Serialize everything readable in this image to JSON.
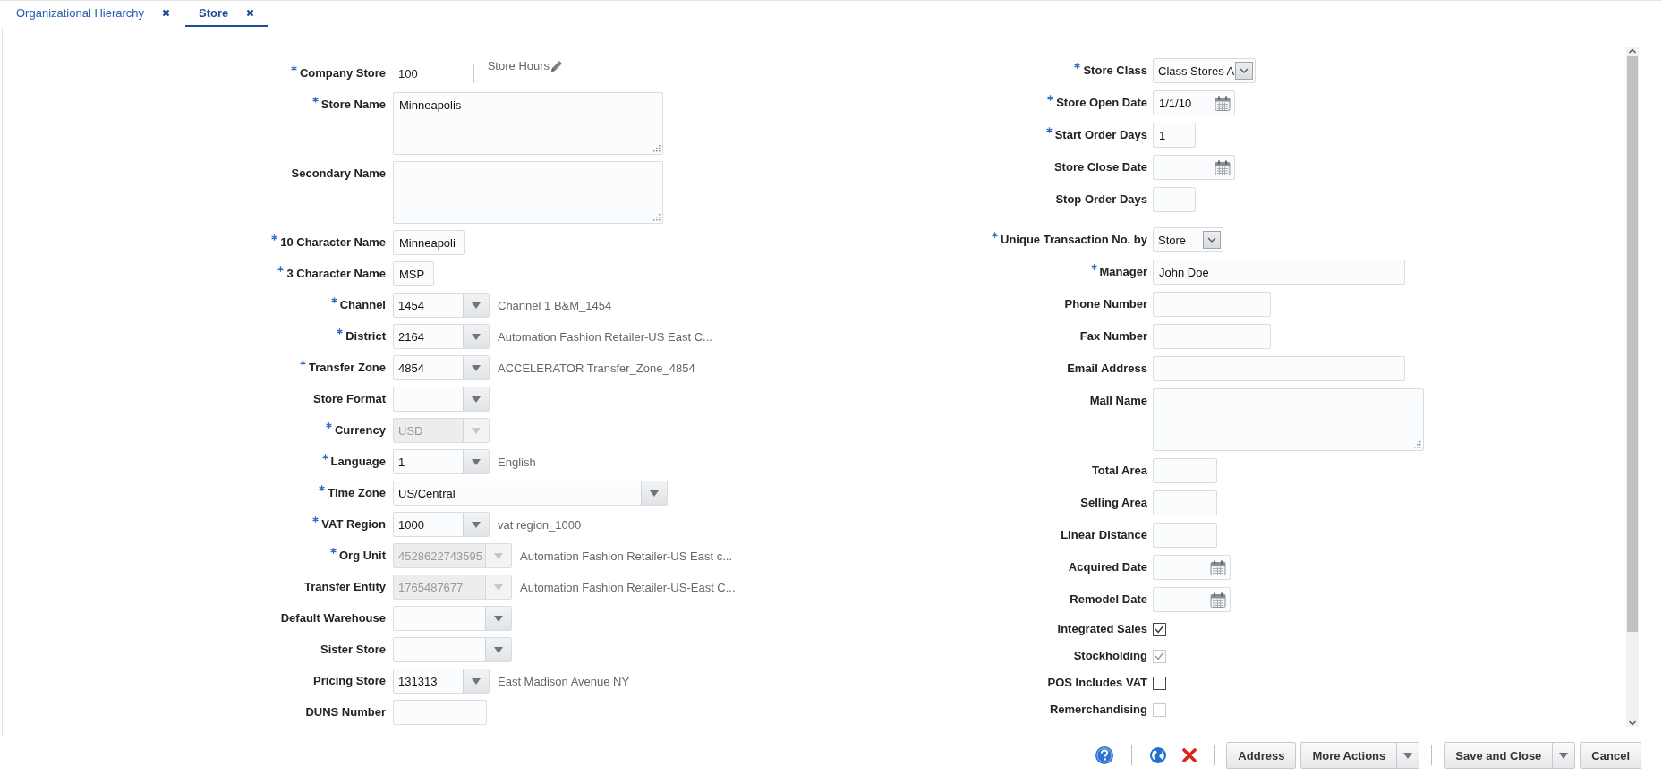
{
  "tabs": [
    {
      "label": "Organizational Hierarchy",
      "selected": false
    },
    {
      "label": "Store",
      "selected": true
    }
  ],
  "left_fields": [
    {
      "kind": "display",
      "label": "Company Store",
      "required": true,
      "disabled": false,
      "value": "100",
      "link": "Store Hours"
    },
    {
      "kind": "textarea",
      "label": "Store Name",
      "required": true,
      "disabled": false,
      "value": "Minneapolis"
    },
    {
      "kind": "textarea",
      "label": "Secondary Name",
      "required": false,
      "disabled": false
    },
    {
      "kind": "text",
      "label": "10 Character Name",
      "required": true,
      "disabled": false,
      "value": "Minneapoli"
    },
    {
      "kind": "text",
      "label": "3 Character Name",
      "required": true,
      "disabled": false,
      "value": "MSP"
    },
    {
      "kind": "select",
      "label": "Channel",
      "required": true,
      "disabled": false,
      "value": "1454",
      "description": "Channel 1 B&M_1454"
    },
    {
      "kind": "select",
      "label": "District",
      "required": true,
      "disabled": false,
      "value": "2164",
      "description": "Automation Fashion Retailer-US East C..."
    },
    {
      "kind": "select",
      "label": "Transfer Zone",
      "required": true,
      "disabled": false,
      "value": "4854",
      "description": "ACCELERATOR Transfer_Zone_4854"
    },
    {
      "kind": "select",
      "label": "Store Format",
      "required": false,
      "disabled": false
    },
    {
      "kind": "select",
      "label": "Currency",
      "required": true,
      "disabled": true,
      "value": "USD"
    },
    {
      "kind": "select",
      "label": "Language",
      "required": true,
      "disabled": false,
      "value": "1",
      "description": "English"
    },
    {
      "kind": "select",
      "label": "Time Zone",
      "required": true,
      "disabled": false,
      "value": "US/Central"
    },
    {
      "kind": "select",
      "label": "VAT Region",
      "required": true,
      "disabled": false,
      "value": "1000",
      "description": "vat region_1000"
    },
    {
      "kind": "select",
      "label": "Org Unit",
      "required": true,
      "disabled": true,
      "value": "4528622743595",
      "description": "Automation Fashion Retailer-US East c..."
    },
    {
      "kind": "select",
      "label": "Transfer Entity",
      "required": false,
      "disabled": true,
      "value": "1765487677",
      "description": "Automation Fashion Retailer-US-East C..."
    },
    {
      "kind": "select",
      "label": "Default Warehouse",
      "required": false,
      "disabled": false
    },
    {
      "kind": "select",
      "label": "Sister Store",
      "required": false,
      "disabled": false
    },
    {
      "kind": "select",
      "label": "Pricing Store",
      "required": false,
      "disabled": false,
      "value": "131313",
      "description": "East Madison Avenue NY"
    },
    {
      "kind": "text",
      "label": "DUNS Number",
      "required": false,
      "disabled": false
    }
  ],
  "right_fields": [
    {
      "kind": "choice",
      "label": "Store Class",
      "required": true,
      "disabled": false,
      "value": "Class Stores A"
    },
    {
      "kind": "date",
      "label": "Store Open Date",
      "required": true,
      "disabled": false,
      "value": "1/1/10"
    },
    {
      "kind": "text",
      "label": "Start Order Days",
      "required": true,
      "disabled": false,
      "value": "1"
    },
    {
      "kind": "date",
      "label": "Store Close Date",
      "required": false,
      "disabled": false
    },
    {
      "kind": "text",
      "label": "Stop Order Days",
      "required": false,
      "disabled": false
    },
    {
      "kind": "choice",
      "label": "Unique Transaction No. by",
      "required": true,
      "disabled": false,
      "value": "Store"
    },
    {
      "kind": "text",
      "label": "Manager",
      "required": true,
      "disabled": false,
      "value": "John Doe"
    },
    {
      "kind": "text",
      "label": "Phone Number",
      "required": false,
      "disabled": false
    },
    {
      "kind": "text",
      "label": "Fax Number",
      "required": false,
      "disabled": false
    },
    {
      "kind": "text",
      "label": "Email Address",
      "required": false,
      "disabled": false
    },
    {
      "kind": "textarea",
      "label": "Mall Name",
      "required": false,
      "disabled": false
    },
    {
      "kind": "text",
      "label": "Total Area",
      "required": false,
      "disabled": false
    },
    {
      "kind": "text",
      "label": "Selling Area",
      "required": false,
      "disabled": false
    },
    {
      "kind": "text",
      "label": "Linear Distance",
      "required": false,
      "disabled": false
    },
    {
      "kind": "date",
      "label": "Acquired Date",
      "required": false,
      "disabled": false
    },
    {
      "kind": "date",
      "label": "Remodel Date",
      "required": false,
      "disabled": false
    },
    {
      "kind": "checkbox",
      "label": "Integrated Sales",
      "required": false,
      "disabled": false,
      "checked": true
    },
    {
      "kind": "checkbox",
      "label": "Stockholding",
      "required": false,
      "disabled": true,
      "checked": true
    },
    {
      "kind": "checkbox",
      "label": "POS Includes VAT",
      "required": false,
      "disabled": false,
      "checked": false
    },
    {
      "kind": "checkbox",
      "label": "Remerchandising",
      "required": false,
      "disabled": true,
      "checked": false
    }
  ],
  "footer": {
    "button_groups": [
      [
        {
          "label": "Address",
          "menu": false
        },
        {
          "label": "More Actions",
          "menu": true
        }
      ],
      [
        {
          "label": "Save and Close",
          "menu": true
        },
        {
          "label": "Cancel",
          "menu": false
        }
      ]
    ]
  }
}
